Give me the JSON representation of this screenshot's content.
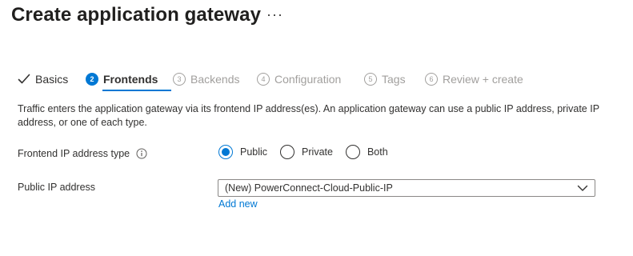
{
  "header": {
    "title": "Create application gateway",
    "more_label": "···"
  },
  "tabs": [
    {
      "label": "Basics",
      "state": "completed",
      "icon": "checkmark-icon"
    },
    {
      "label": "Frontends",
      "number": "2",
      "state": "active"
    },
    {
      "label": "Backends",
      "number": "3",
      "state": "pending"
    },
    {
      "label": "Configuration",
      "number": "4",
      "state": "pending"
    },
    {
      "label": "Tags",
      "number": "5",
      "state": "pending"
    },
    {
      "label": "Review + create",
      "number": "6",
      "state": "pending"
    }
  ],
  "intro_text": "Traffic enters the application gateway via its frontend IP address(es). An application gateway can use a public IP address, private IP address, or one of each type.",
  "form": {
    "frontend_ip_type": {
      "label": "Frontend IP address type",
      "icon": "info-icon",
      "options": [
        {
          "label": "Public",
          "selected": true
        },
        {
          "label": "Private",
          "selected": false
        },
        {
          "label": "Both",
          "selected": false
        }
      ]
    },
    "public_ip": {
      "label": "Public IP address",
      "selected_value": "(New) PowerConnect-Cloud-Public-IP",
      "add_new_label": "Add new"
    }
  },
  "colors": {
    "accent": "#0078d4",
    "text": "#323130",
    "disabled": "#a19f9d"
  }
}
